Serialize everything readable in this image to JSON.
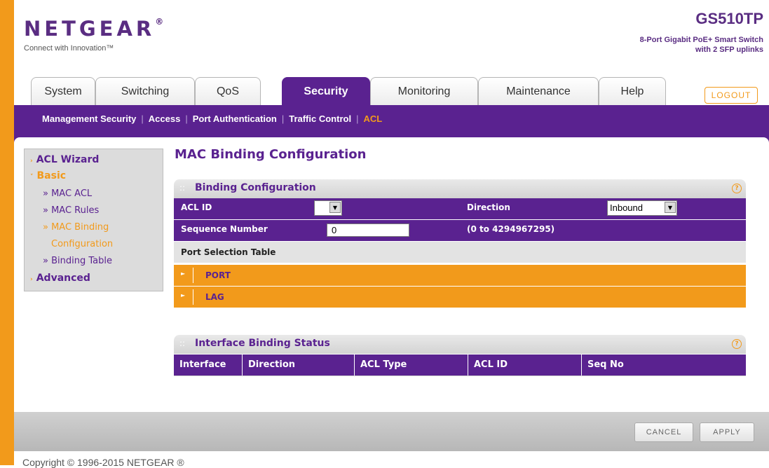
{
  "brand": {
    "logo": "NETGEAR",
    "logo_mark": "®",
    "tagline": "Connect with Innovation™",
    "model": "GS510TP",
    "model_desc_1": "8-Port Gigabit PoE+ Smart Switch",
    "model_desc_2": "with 2 SFP uplinks"
  },
  "tabs": [
    "System",
    "Switching",
    "QoS",
    "Security",
    "Monitoring",
    "Maintenance",
    "Help"
  ],
  "active_tab": "Security",
  "logout_label": "LOGOUT",
  "subnav": {
    "items": [
      "Management Security",
      "Access",
      "Port Authentication",
      "Traffic Control",
      "ACL"
    ],
    "active": "ACL"
  },
  "sidemenu": {
    "acl_wizard": "ACL Wizard",
    "basic": "Basic",
    "mac_acl": "» MAC ACL",
    "mac_rules": "» MAC Rules",
    "mac_binding_1": "» MAC Binding",
    "mac_binding_2": "Configuration",
    "binding_table": "» Binding Table",
    "advanced": "Advanced"
  },
  "page_title": "MAC Binding Configuration",
  "binding_config": {
    "title": "Binding Configuration",
    "acl_id_label": "ACL ID",
    "acl_id_value": "",
    "direction_label": "Direction",
    "direction_value": "Inbound",
    "sequence_label": "Sequence Number",
    "sequence_value": "0",
    "sequence_range": "(0 to 4294967295)",
    "port_selection_label": "Port Selection Table",
    "port_label": "PORT",
    "lag_label": "LAG"
  },
  "interface_status": {
    "title": "Interface Binding Status",
    "columns": [
      "Interface",
      "Direction",
      "ACL Type",
      "ACL ID",
      "Seq No"
    ]
  },
  "buttons": {
    "cancel": "CANCEL",
    "apply": "APPLY"
  },
  "copyright": "Copyright © 1996-2015 NETGEAR ®",
  "colors": {
    "brand_purple": "#5a2290",
    "accent_orange": "#f29a1b"
  }
}
